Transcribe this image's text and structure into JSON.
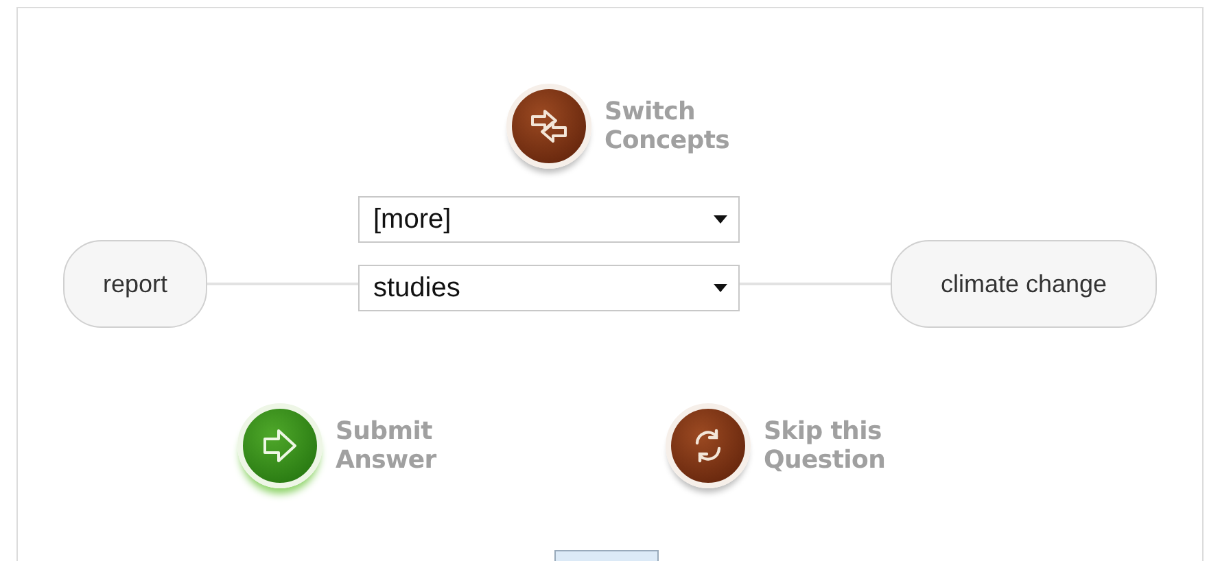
{
  "switch_button": {
    "label": "Switch Concepts"
  },
  "concept_map": {
    "left_node": "report",
    "right_node": "climate change",
    "dropdowns": [
      {
        "value": "[more]"
      },
      {
        "value": "studies"
      }
    ]
  },
  "actions": [
    {
      "kind": "submit",
      "label": "Submit Answer"
    },
    {
      "kind": "skip",
      "label": "Skip this Question"
    }
  ]
}
